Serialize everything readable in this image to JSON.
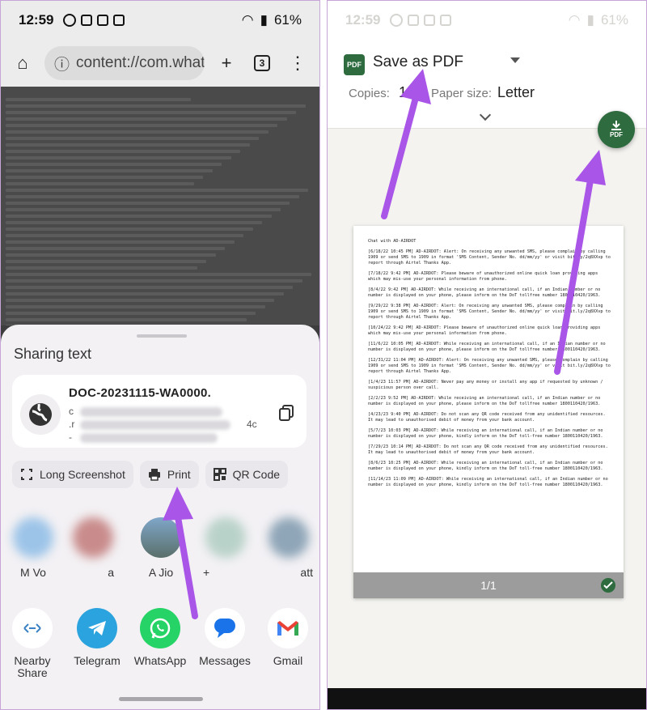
{
  "colors": {
    "accent_green": "#2e6b3e",
    "arrow_purple": "#a855e8",
    "sheet_bg": "#f3f1f4",
    "dim_bg": "#3d3d3d"
  },
  "left": {
    "status": {
      "time": "12:59",
      "battery": "61%"
    },
    "browser": {
      "url": "content://com.whatsapp",
      "tab_count": "3"
    },
    "sheet": {
      "title": "Sharing text",
      "file_name": "DOC-20231115-WA0000.",
      "frag_c": "c",
      "frag_r": ".r",
      "frag_4c": "4c",
      "frag_dash": "-",
      "actions": [
        {
          "label": "Long Screenshot"
        },
        {
          "label": "Print"
        },
        {
          "label": "QR Code"
        }
      ],
      "contacts": [
        {
          "name": "M Vo"
        },
        {
          "name": "a"
        },
        {
          "name": "A Jio"
        },
        {
          "name": "+"
        },
        {
          "name": "att"
        }
      ],
      "apps": [
        {
          "name": "Nearby\nShare"
        },
        {
          "name": "Telegram"
        },
        {
          "name": "WhatsApp"
        },
        {
          "name": "Messages"
        },
        {
          "name": "Gmail"
        }
      ]
    }
  },
  "right": {
    "status": {
      "time": "12:59",
      "battery": "61%"
    },
    "printer": {
      "name": "Save as PDF",
      "copies_label": "Copies:",
      "copies_value": "1",
      "paper_label": "Paper size:",
      "paper_value": "Letter"
    },
    "fab_label": "PDF",
    "preview": {
      "page_indicator": "1/1",
      "lines": [
        "Chat with AD-AIRDOT",
        "[6/18/22 10:45 PM] AD-AIRDOT: Alert: On receiving any unwanted SMS, please complain by calling 1909 or send SMS to 1909 in format 'SMS Content, Sender No. dd/mm/yy' or visit bit.ly/2q8XXvp to report through Airtel Thanks App.",
        "[7/18/22 9:42 PM] AD-AIRDOT: Please beware of unauthorized online quick loan providing apps which may mis-use your personal information from phone.",
        "[8/4/22 9:42 PM] AD-AIRDOT: While receiving an international call, if an Indian number or no number is displayed on your phone, please inform on the DoT tollfree number 1800110420/1963.",
        "[9/29/22 9:38 PM] AD-AIRDOT: Alert: On receiving any unwanted SMS, please complain by calling 1909 or send SMS to 1909 in format 'SMS Content, Sender No. dd/mm/yy' or visit bit.ly/2q8XXvp to report through Airtel Thanks App.",
        "[10/24/22 9:42 PM] AD-AIRDOT: Please beware of unauthorized online quick loan providing apps which may mis-use your personal information from phone.",
        "[11/6/22 10:05 PM] AD-AIRDOT: While receiving an international call, if an Indian number or no number is displayed on your phone, please inform on the DoT tollfree number 1800110420/1963.",
        "[12/31/22 11:04 PM] AD-AIRDOT: Alert: On receiving any unwanted SMS, please complain by calling 1909 or send SMS to 1909 in format 'SMS Content, Sender No. dd/mm/yy' or visit bit.ly/2q8XXvp to report through Airtel Thanks App.",
        "[1/4/23 11:57 PM] AD-AIRDOT: Never pay any money or install any app if requested by unknown / suspicious person over call.",
        "[2/2/23 9:52 PM] AD-AIRDOT: While receiving an international call, if an Indian number or no number is displayed on your phone, please inform on the DoT tollfree number 1800110420/1963.",
        "[4/23/23 9:40 PM] AD-AIRDOT: Do not scan any QR code received from any unidentified resources. It may lead to unauthorised debit of money from your bank account.",
        "[5/7/23 10:03 PM] AD-AIRDOT: While receiving an international call, if an Indian number or no number is displayed on your phone, kindly inform on the DoT toll-free number 1800110420/1963.",
        "[7/29/23 10:14 PM] AD-AIRDOT: Do not scan any QR code received from any unidentified resources. It may lead to unauthorised debit of money from your bank account.",
        "[8/6/23 10:25 PM] AD-AIRDOT: While receiving an international call, if an Indian number or no number is displayed on your phone, kindly inform on the DoT toll-free number 1800110420/1963.",
        "[11/14/23 11:09 PM] AD-AIRDOT: While receiving an international call, if an Indian number or no number is displayed on your phone, kindly inform on the DoT toll-free number 1800110420/1963."
      ]
    }
  }
}
